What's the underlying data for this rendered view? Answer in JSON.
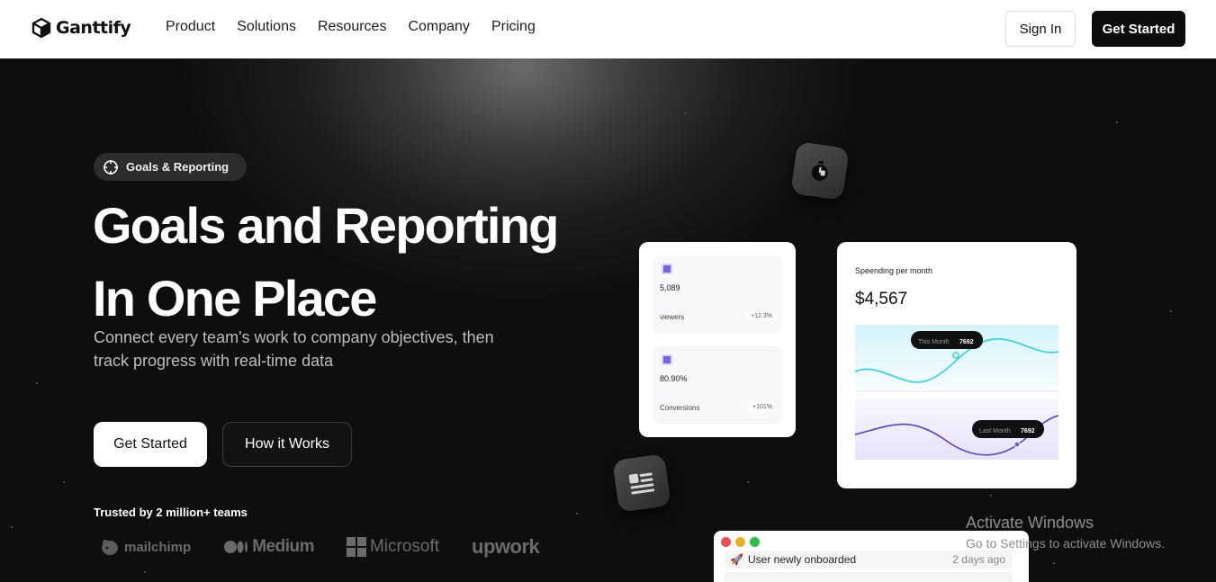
{
  "nav": {
    "brand": "Ganttify",
    "links": [
      "Product",
      "Solutions",
      "Resources",
      "Company",
      "Pricing"
    ],
    "sign_in": "Sign In",
    "get_started": "Get Started"
  },
  "hero": {
    "badge": "Goals & Reporting",
    "headline_line1": "Goals and Reporting",
    "headline_line2": "In One Place",
    "subtext": "Connect every team's work to company objectives, then track progress with real-time data",
    "primary_cta": "Get Started",
    "secondary_cta": "How it Works",
    "trusted": "Trusted by 2 million+ teams",
    "brands": [
      "mailchimp",
      "Medium",
      "Microsoft",
      "upwork"
    ]
  },
  "stats": [
    {
      "value": "5,089",
      "label": "viewers",
      "change": "+12.3%"
    },
    {
      "value": "80.90%",
      "label": "Conversions",
      "change": "+101%"
    }
  ],
  "spending": {
    "title": "Speending per month",
    "amount": "$4,567",
    "this_month_label": "This Month",
    "this_month_value": "7692",
    "last_month_label": "Last Month",
    "last_month_value": "7692"
  },
  "notifications": [
    {
      "icon": "🚀",
      "text": "User newly onboarded",
      "time": "2 days ago"
    }
  ],
  "watermark": {
    "title": "Activate Windows",
    "subtitle": "Go to Settings to activate Windows."
  },
  "colors": {
    "accent": "#7463e8",
    "cyan_line": "#2fd0ea",
    "purple_line": "#5b3fd8"
  }
}
